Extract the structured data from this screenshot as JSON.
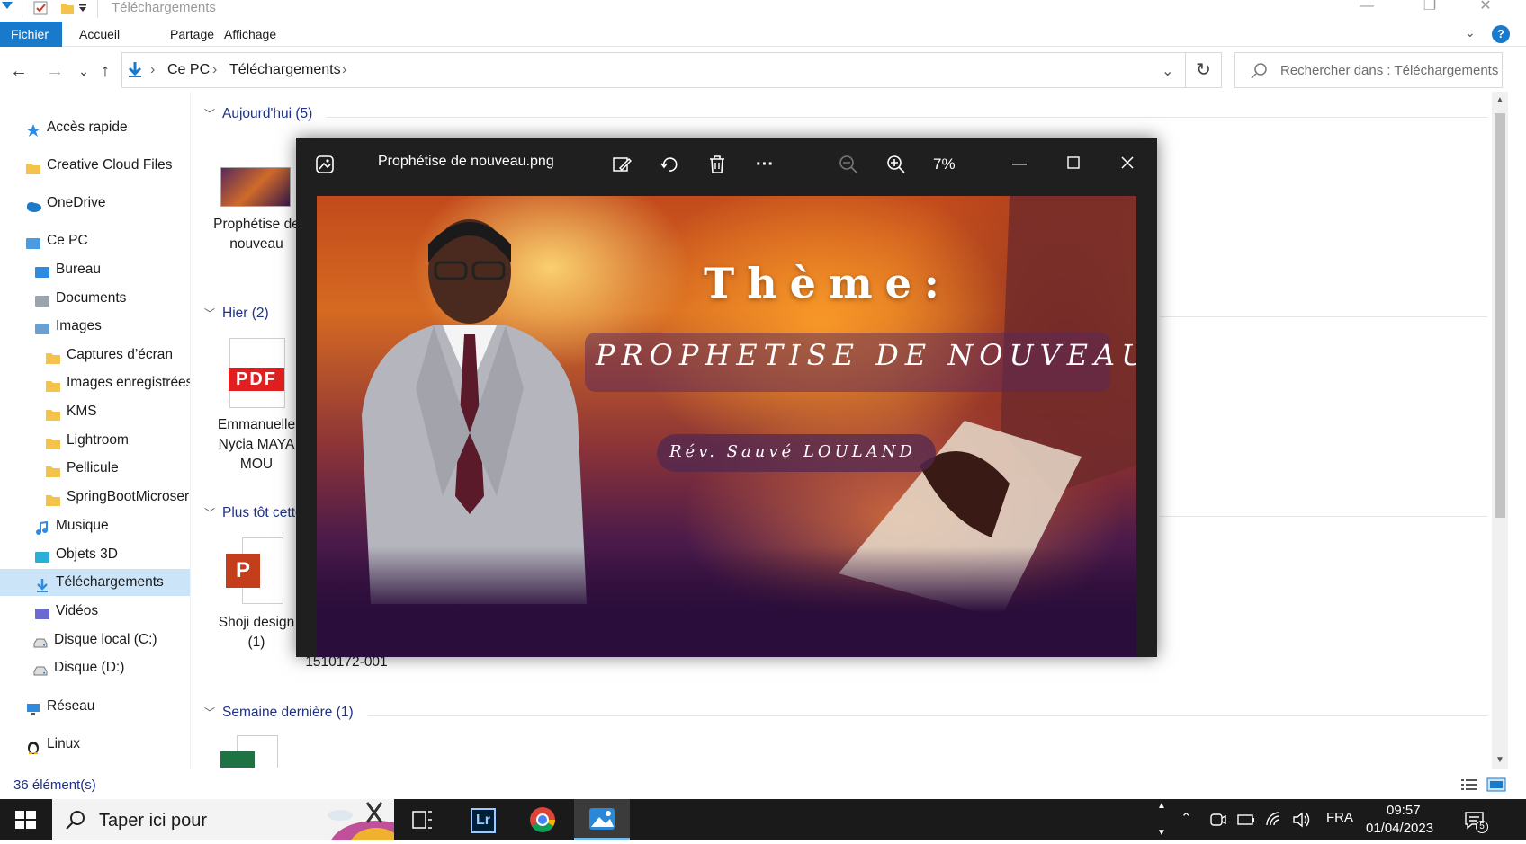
{
  "window": {
    "title": "Téléchargements",
    "minimize_glyph": "—",
    "restore_glyph": "❐",
    "close_glyph": "✕"
  },
  "ribbon": {
    "tabs": [
      "Fichier",
      "Accueil",
      "Partage",
      "Affichage"
    ],
    "active_tab": "Fichier",
    "help_glyph": "?",
    "expand_glyph": "⌄"
  },
  "address": {
    "back_glyph": "←",
    "forward_glyph": "→",
    "recent_glyph": "⌄",
    "up_glyph": "↑",
    "crumbs": [
      "Ce PC",
      "Téléchargements"
    ],
    "separator": "›",
    "refresh_glyph": "↻",
    "search_placeholder": "Rechercher dans : Téléchargements"
  },
  "sidebar": {
    "items": [
      {
        "label": "Accès rapide",
        "icon": "star-icon"
      },
      {
        "label": "Creative Cloud Files",
        "icon": "creative-cloud-folder-icon"
      },
      {
        "label": "OneDrive",
        "icon": "onedrive-cloud-icon"
      },
      {
        "label": "Ce PC",
        "icon": "computer-icon"
      },
      {
        "label": "Bureau",
        "icon": "desktop-icon"
      },
      {
        "label": "Documents",
        "icon": "documents-icon"
      },
      {
        "label": "Images",
        "icon": "pictures-icon"
      },
      {
        "label": "Captures d’écran",
        "icon": "folder-icon"
      },
      {
        "label": "Images enregistrées",
        "icon": "folder-icon"
      },
      {
        "label": "KMS",
        "icon": "folder-icon"
      },
      {
        "label": "Lightroom",
        "icon": "folder-icon"
      },
      {
        "label": "Pellicule",
        "icon": "folder-icon"
      },
      {
        "label": "SpringBootMicroser",
        "icon": "folder-icon"
      },
      {
        "label": "Musique",
        "icon": "music-icon"
      },
      {
        "label": "Objets 3D",
        "icon": "3d-objects-icon"
      },
      {
        "label": "Téléchargements",
        "icon": "downloads-icon",
        "selected": true
      },
      {
        "label": "Vidéos",
        "icon": "videos-icon"
      },
      {
        "label": "Disque local (C:)",
        "icon": "drive-icon"
      },
      {
        "label": "Disque (D:)",
        "icon": "drive-icon"
      },
      {
        "label": "Réseau",
        "icon": "network-icon"
      },
      {
        "label": "Linux",
        "icon": "linux-penguin-icon"
      }
    ]
  },
  "content": {
    "groups": [
      {
        "header": "Aujourd'hui (5)"
      },
      {
        "header": "Hier (2)"
      },
      {
        "header": "Plus tôt cette"
      },
      {
        "header": "Semaine dernière (1)"
      }
    ],
    "files": [
      {
        "label": "Prophétise de nouveau",
        "icon": "image-thumbnail-icon"
      },
      {
        "label": "Emmanuelle Nycia MAYAMOU",
        "icon": "pdf-file-icon",
        "icon_text": "PDF"
      },
      {
        "label": "Shoji design (1)",
        "icon": "powerpoint-file-icon"
      },
      {
        "label": "1510172-001",
        "icon": "file-icon"
      },
      {
        "label": "",
        "icon": "excel-file-icon"
      }
    ]
  },
  "status": {
    "count": "36 élément(s)"
  },
  "viewer": {
    "title": "Prophétise de nouveau.png",
    "zoom": "7%",
    "toolbar": [
      "edit-image-icon",
      "rotate-icon",
      "delete-icon",
      "more-icon",
      "zoom-out-icon",
      "zoom-in-icon"
    ],
    "more_glyph": "···",
    "image": {
      "theme": "Thème:",
      "title": "PROPHETISE DE NOUVEAU",
      "speaker": "Rév. Sauvé LOULAND"
    }
  },
  "taskbar": {
    "search_text": "Taper ici pour",
    "apps": [
      "task-view-icon",
      "lightroom-icon",
      "chrome-icon",
      "photos-icon"
    ],
    "lightroom_text": "Lr",
    "language": "FRA",
    "time": "09:57",
    "date": "01/04/2023",
    "notification_count": "5"
  },
  "colors": {
    "accent": "#1979ca",
    "selected_bg": "#cce4f7",
    "group_header": "#1e3287",
    "taskbar_bg": "#1a1a1a",
    "viewer_bg": "#1f1f1f"
  }
}
